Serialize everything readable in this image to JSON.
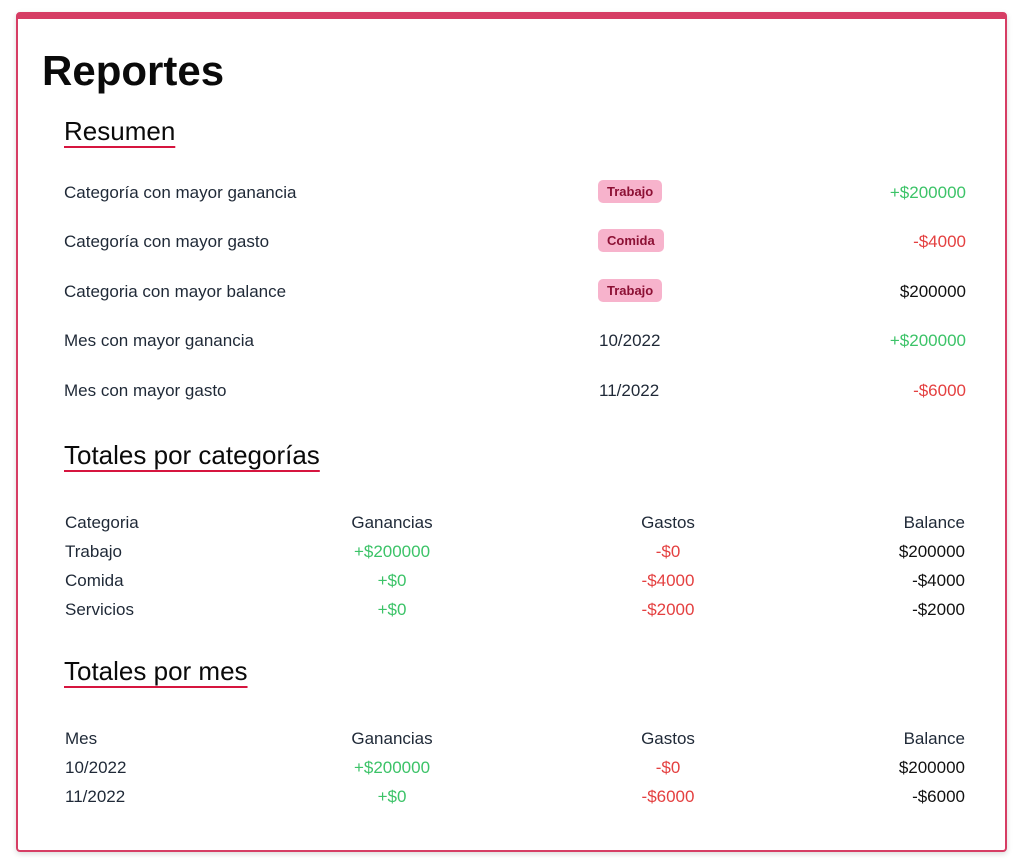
{
  "page": {
    "title": "Reportes"
  },
  "colors": {
    "accent": "#d63d64",
    "positive": "#3cc368",
    "negative": "#e44040",
    "tag_bg": "#f7b3cc",
    "tag_text": "#8c1034"
  },
  "summary": {
    "title": "Resumen",
    "rows": [
      {
        "label": "Categoría con mayor ganancia",
        "tag": "Trabajo",
        "amount": "+$200000"
      },
      {
        "label": "Categoría con mayor gasto",
        "tag": "Comida",
        "amount": "-$4000"
      },
      {
        "label": "Categoria con mayor balance",
        "tag": "Trabajo",
        "amount": "$200000"
      },
      {
        "label": "Mes con mayor ganancia",
        "value": "10/2022",
        "amount": "+$200000"
      },
      {
        "label": "Mes con mayor gasto",
        "value": "11/2022",
        "amount": "-$6000"
      }
    ]
  },
  "by_category": {
    "title": "Totales por categorías",
    "headers": [
      "Categoria",
      "Ganancias",
      "Gastos",
      "Balance"
    ],
    "rows": [
      [
        "Trabajo",
        "+$200000",
        "-$0",
        "$200000"
      ],
      [
        "Comida",
        "+$0",
        "-$4000",
        "-$4000"
      ],
      [
        "Servicios",
        "+$0",
        "-$2000",
        "-$2000"
      ]
    ]
  },
  "by_month": {
    "title": "Totales por mes",
    "headers": [
      "Mes",
      "Ganancias",
      "Gastos",
      "Balance"
    ],
    "rows": [
      [
        "10/2022",
        "+$200000",
        "-$0",
        "$200000"
      ],
      [
        "11/2022",
        "+$0",
        "-$6000",
        "-$6000"
      ]
    ]
  }
}
